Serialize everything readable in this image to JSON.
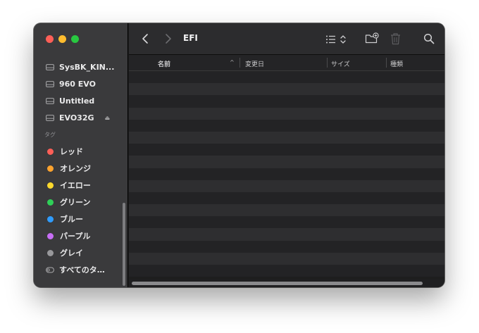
{
  "window": {
    "title": "EFI"
  },
  "sidebar": {
    "locations": [
      {
        "label": "SysBK_KIN...",
        "icon": "drive-icon",
        "eject": false
      },
      {
        "label": "960 EVO",
        "icon": "drive-icon",
        "eject": false
      },
      {
        "label": "Untitled",
        "icon": "drive-icon",
        "eject": false
      },
      {
        "label": "EVO32G",
        "icon": "drive-icon",
        "eject": true
      }
    ],
    "tags_header": "タグ",
    "tags": [
      {
        "label": "レッド",
        "color": "#fe5f57"
      },
      {
        "label": "オレンジ",
        "color": "#fea32e"
      },
      {
        "label": "イエロー",
        "color": "#fdd92d"
      },
      {
        "label": "グリーン",
        "color": "#2fd058"
      },
      {
        "label": "ブルー",
        "color": "#2f9cfe"
      },
      {
        "label": "パープル",
        "color": "#c76ef6"
      },
      {
        "label": "グレイ",
        "color": "#98989b"
      }
    ],
    "all_tags": "すべてのタ…"
  },
  "columns": {
    "name": "名前",
    "date": "変更日",
    "size": "サイズ",
    "kind": "種類",
    "sort_indicator": "^"
  },
  "icons": {
    "eject": "⏏"
  },
  "colors": {
    "sidebar_bg": "#3a3a3c",
    "toolbar_bg": "#2c2c2e",
    "row_odd": "#232325",
    "row_even": "#2e2e30"
  }
}
